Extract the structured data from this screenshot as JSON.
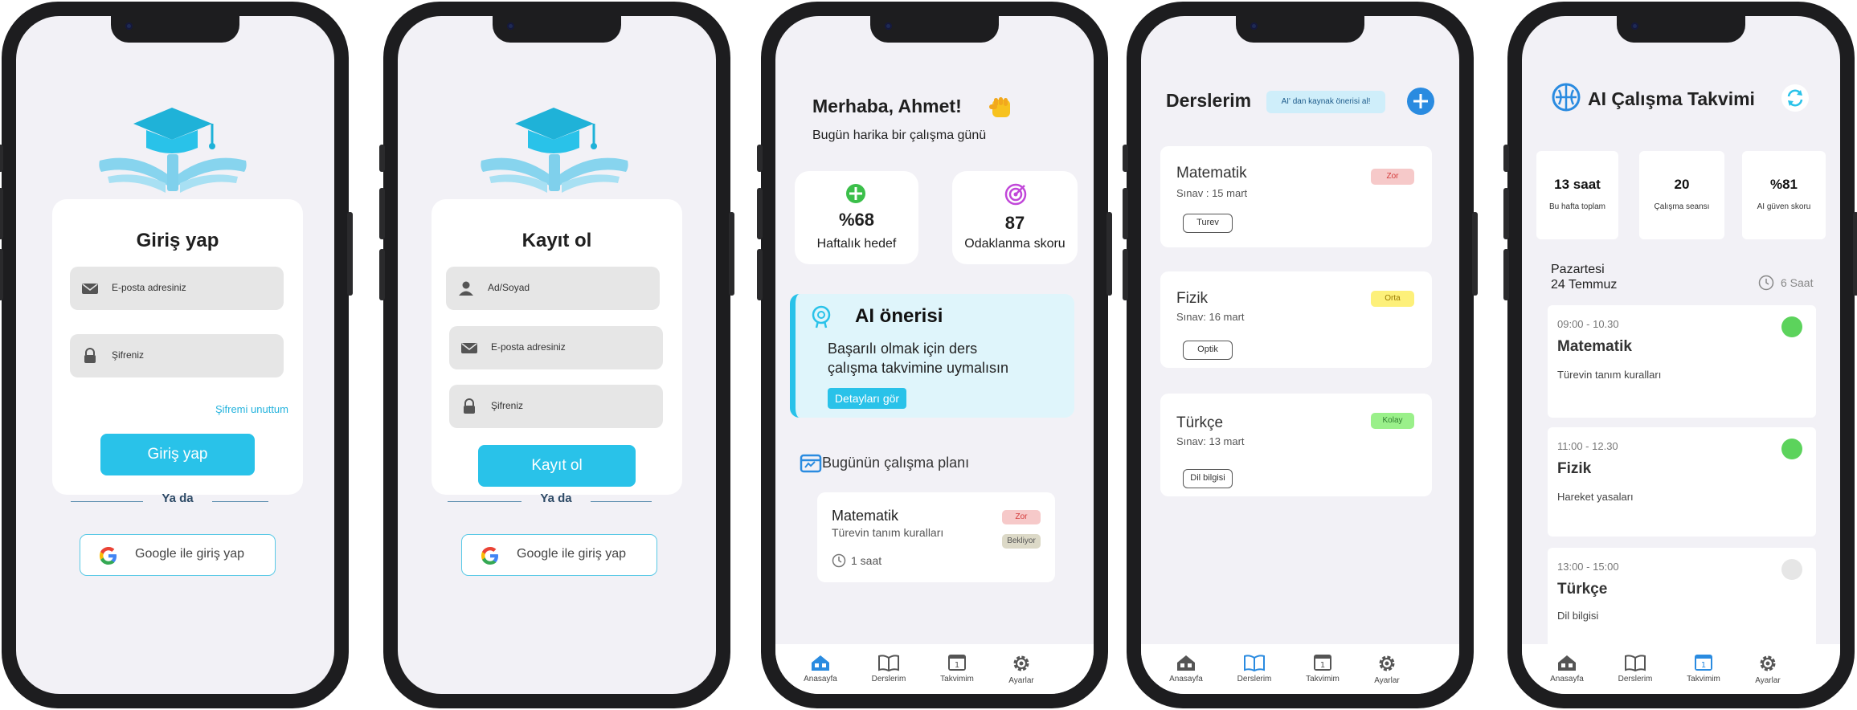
{
  "login": {
    "title": "Giriş yap",
    "email_placeholder": "E-posta adresiniz",
    "password_placeholder": "Şifreniz",
    "forgot": "Şifremi unuttum",
    "submit": "Giriş yap",
    "or": "Ya da",
    "google": "Google ile giriş yap"
  },
  "register": {
    "title": "Kayıt ol",
    "name_placeholder": "Ad/Soyad",
    "email_placeholder": "E-posta adresiniz",
    "password_placeholder": "Şifreniz",
    "submit": "Kayıt ol",
    "or": "Ya da",
    "google": "Google ile giriş yap"
  },
  "home": {
    "greeting": "Merhaba, Ahmet!",
    "subtitle": "Bugün harika bir çalışma günü",
    "stats": [
      {
        "value": "%68",
        "label": "Haftalık hedef"
      },
      {
        "value": "87",
        "label": "Odaklanma skoru"
      }
    ],
    "ai_title": "AI önerisi",
    "ai_text_1": "Başarılı olmak için ders",
    "ai_text_2": "çalışma takvimine uymalısın",
    "ai_button": "Detayları gör",
    "plan_title": "Bugünün çalışma planı",
    "plan": {
      "subject": "Matematik",
      "topic": "Türevin tanım kuralları",
      "difficulty": "Zor",
      "status": "Bekliyor",
      "duration": "1 saat"
    }
  },
  "courses": {
    "title": "Derslerim",
    "ai_source_button": "AI' dan kaynak önerisi al!",
    "items": [
      {
        "name": "Matematik",
        "exam": "Sınav : 15 mart",
        "level": "Zor",
        "tag": "Turev"
      },
      {
        "name": "Fizik",
        "exam": "Sınav: 16 mart",
        "level": "Orta",
        "tag": "Optik"
      },
      {
        "name": "Türkçe",
        "exam": "Sınav: 13 mart",
        "level": "Kolay",
        "tag": "Dil bilgisi"
      }
    ]
  },
  "calendar": {
    "title": "AI Çalışma Takvimi",
    "stats": [
      {
        "value": "13 saat",
        "label": "Bu hafta toplam"
      },
      {
        "value": "20",
        "label": "Çalışma seansı"
      },
      {
        "value": "%81",
        "label": "AI güven skoru"
      }
    ],
    "day": "Pazartesi",
    "date": "24 Temmuz",
    "total": "6 Saat",
    "sessions": [
      {
        "time": "09:00 - 10.30",
        "subject": "Matematik",
        "topic": "Türevin tanım kuralları",
        "done": true
      },
      {
        "time": "11:00 - 12.30",
        "subject": "Fizik",
        "topic": "Hareket yasaları",
        "done": true
      },
      {
        "time": "13:00 - 15:00",
        "subject": "Türkçe",
        "topic": "Dil bilgisi",
        "done": false
      }
    ]
  },
  "nav": {
    "home": "Anasayfa",
    "courses": "Derslerim",
    "calendar": "Takvimim",
    "settings": "Ayarlar",
    "calendar_icon_number": "1"
  },
  "colors": {
    "accent": "#29c2e9",
    "active_nav": "#2a8be0",
    "done": "#5cd35c",
    "pending": "#e6e6e6",
    "hard": "#f6c9c9",
    "medium": "#fdf07a",
    "easy": "#9af08a"
  }
}
